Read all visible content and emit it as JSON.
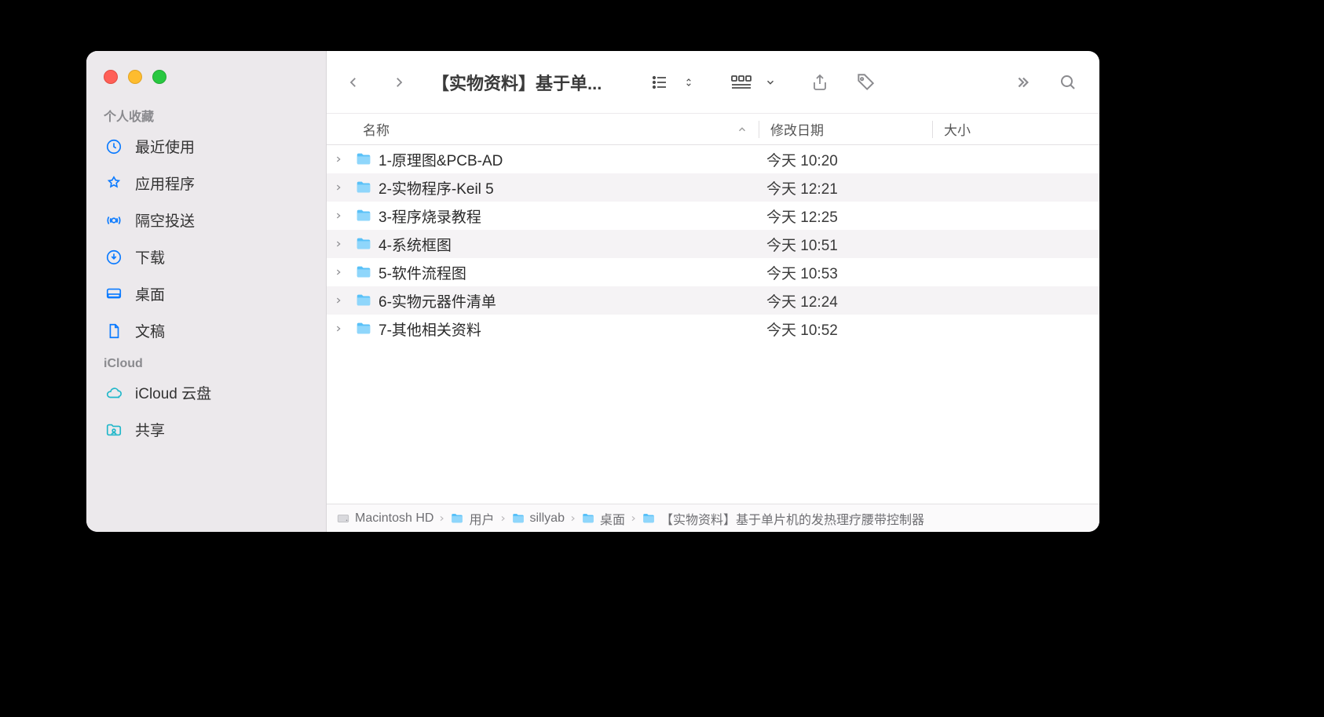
{
  "window": {
    "title": "【实物资料】基于单...",
    "title_full": "【实物资料】基于单片机的发热理疗腰带控制器"
  },
  "sidebar": {
    "sections": [
      {
        "title": "个人收藏",
        "items": [
          {
            "icon": "clock",
            "label": "最近使用"
          },
          {
            "icon": "apps",
            "label": "应用程序"
          },
          {
            "icon": "airdrop",
            "label": "隔空投送"
          },
          {
            "icon": "download",
            "label": "下载"
          },
          {
            "icon": "desktop",
            "label": "桌面"
          },
          {
            "icon": "doc",
            "label": "文稿"
          }
        ]
      },
      {
        "title": "iCloud",
        "items": [
          {
            "icon": "cloud",
            "label": "iCloud 云盘"
          },
          {
            "icon": "shared",
            "label": "共享"
          }
        ]
      }
    ]
  },
  "columns": {
    "name": "名称",
    "date": "修改日期",
    "size": "大小",
    "sort_asc": true
  },
  "files": [
    {
      "name": "1-原理图&PCB-AD",
      "date": "今天 10:20",
      "size": ""
    },
    {
      "name": "2-实物程序-Keil 5",
      "date": "今天 12:21",
      "size": ""
    },
    {
      "name": "3-程序烧录教程",
      "date": "今天 12:25",
      "size": ""
    },
    {
      "name": "4-系统框图",
      "date": "今天 10:51",
      "size": ""
    },
    {
      "name": "5-软件流程图",
      "date": "今天 10:53",
      "size": ""
    },
    {
      "name": "6-实物元器件清单",
      "date": "今天 12:24",
      "size": ""
    },
    {
      "name": "7-其他相关资料",
      "date": "今天 10:52",
      "size": ""
    }
  ],
  "path": [
    {
      "icon": "hd",
      "label": "Macintosh HD"
    },
    {
      "icon": "folder",
      "label": "用户"
    },
    {
      "icon": "folder",
      "label": "sillyab"
    },
    {
      "icon": "folder",
      "label": "桌面"
    },
    {
      "icon": "folder",
      "label": "【实物资料】基于单片机的发热理疗腰带控制器"
    }
  ]
}
